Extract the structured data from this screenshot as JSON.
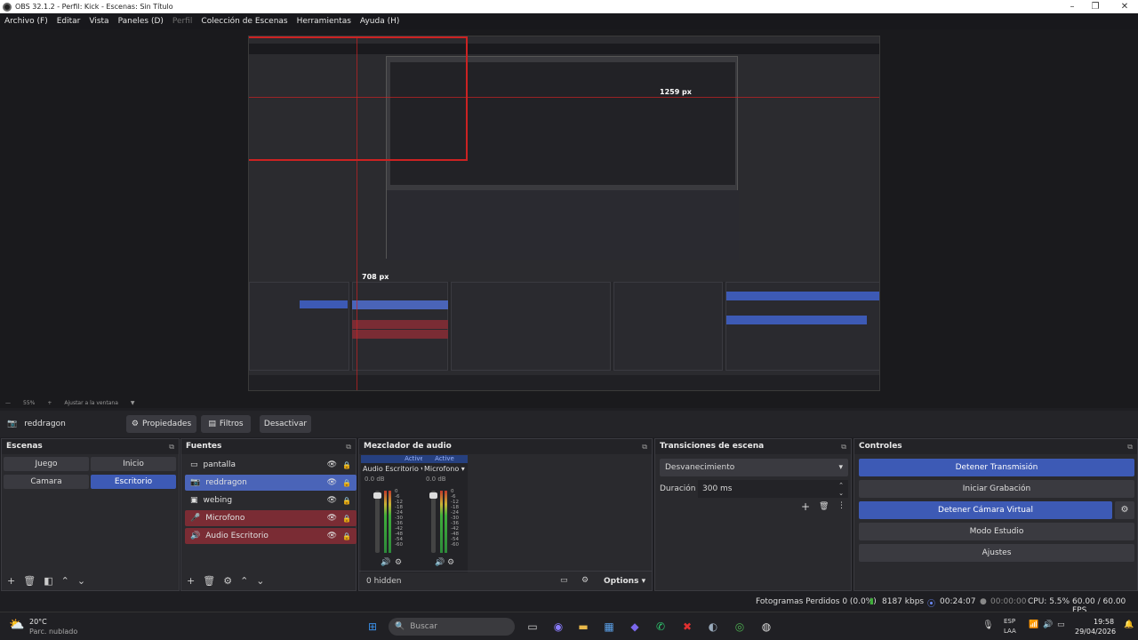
{
  "window": {
    "title": "OBS 32.1.2 - Perfil: Kick - Escenas: Sin Título",
    "min": "–",
    "max": "❐",
    "close": "✕"
  },
  "menu": [
    "Archivo (F)",
    "Editar",
    "Vista",
    "Paneles (D)",
    "Perfil",
    "Colección de Escenas",
    "Herramientas",
    "Ayuda (H)"
  ],
  "preview": {
    "label_width": "1259 px",
    "label_height": "708 px"
  },
  "zoom": {
    "value": "55%",
    "fit": "Ajustar a la ventana"
  },
  "source_bar": {
    "selected": "reddragon",
    "properties": "Propiedades",
    "filters": "Filtros",
    "deactivate": "Desactivar"
  },
  "scenes": {
    "title": "Escenas",
    "items": [
      "Juego",
      "Inicio",
      "Camara",
      "Escritorio"
    ],
    "active": "Escritorio"
  },
  "sources": {
    "title": "Fuentes",
    "items": [
      "pantalla",
      "reddragon",
      "webing",
      "Microfono",
      "Audio Escritorio"
    ]
  },
  "mixer": {
    "title": "Mezclador de audio",
    "channels": [
      {
        "name": "Audio Escritorio",
        "status": "Active",
        "db": "0.0 dB"
      },
      {
        "name": "Microfono",
        "status": "Active",
        "db": "0.0 dB"
      }
    ],
    "scale": [
      "0",
      "-6",
      "-12",
      "-18",
      "-24",
      "-30",
      "-36",
      "-42",
      "-48",
      "-54",
      "-60"
    ],
    "hidden": "0 hidden",
    "options": "Options"
  },
  "transitions": {
    "title": "Transiciones de escena",
    "type": "Desvanecimiento",
    "duration_label": "Duración",
    "duration": "300 ms"
  },
  "controls": {
    "title": "Controles",
    "buttons": [
      "Detener Transmisión",
      "Iniciar Grabación",
      "Detener Cámara Virtual",
      "Modo Estudio",
      "Ajustes"
    ]
  },
  "status": {
    "dropped": "Fotogramas Perdidos 0 (0.0%)",
    "bitrate": "8187 kbps",
    "stream_time": "00:24:07",
    "rec_time": "00:00:00",
    "cpu": "CPU: 5.5%",
    "fps": "60.00 / 60.00 FPS"
  },
  "taskbar": {
    "weather_temp": "20°C",
    "weather_desc": "Parc. nublado",
    "search": "Buscar",
    "lang1": "ESP",
    "lang2": "LAA",
    "time": "19:58",
    "date": "29/04/2026"
  }
}
